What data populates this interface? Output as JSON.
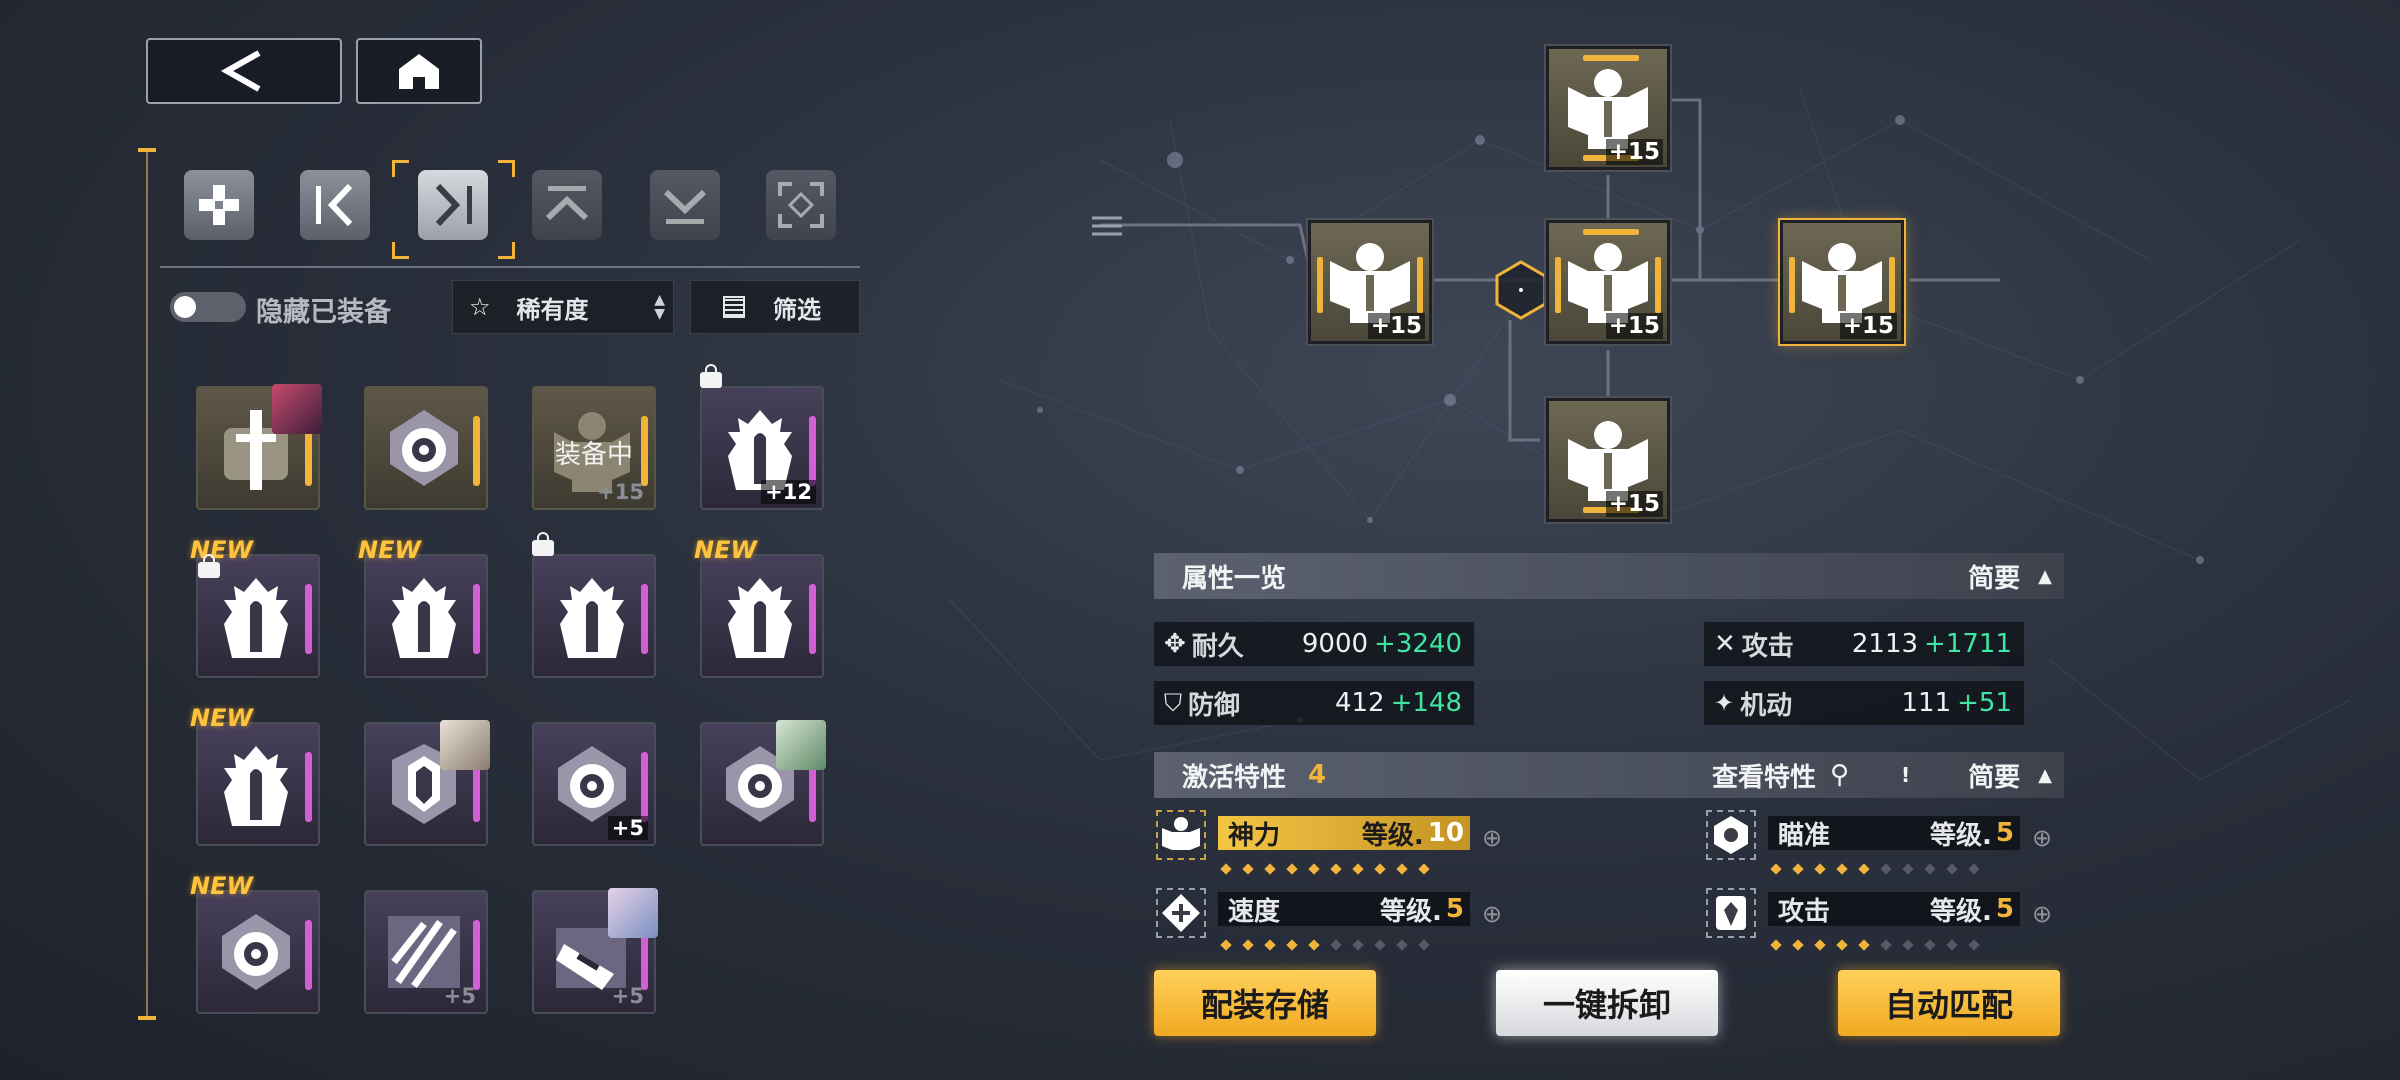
{
  "nav": {
    "back_icon": "chevron-left-icon",
    "home_icon": "home-icon"
  },
  "category_tabs": [
    {
      "icon": "cross-icon",
      "state": "normal"
    },
    {
      "icon": "chevron-left-bracket-icon",
      "state": "normal"
    },
    {
      "icon": "chevron-right-bracket-icon",
      "state": "selected"
    },
    {
      "icon": "chevron-up-icon",
      "state": "dim"
    },
    {
      "icon": "chevron-down-icon",
      "state": "dim"
    },
    {
      "icon": "frame-icon",
      "state": "dim"
    }
  ],
  "filters": {
    "hide_equipped_label": "隐藏已装备",
    "sort_label": "稀有度",
    "filter_label": "筛选"
  },
  "items": [
    {
      "type": "gold",
      "icon": "blade-icon",
      "avatar": true
    },
    {
      "type": "gold",
      "icon": "target-icon"
    },
    {
      "type": "gold",
      "icon": "armor-icon",
      "equipped_label": "装备中",
      "level": "+15",
      "level_faint": true
    },
    {
      "type": "purple",
      "icon": "spike-icon",
      "lock": true,
      "level": "+12"
    },
    {
      "type": "purple",
      "icon": "spike-icon",
      "new": "NEW",
      "lock": true
    },
    {
      "type": "purple",
      "icon": "spike-icon",
      "new": "NEW"
    },
    {
      "type": "purple",
      "icon": "spike-icon",
      "lock": true
    },
    {
      "type": "purple",
      "icon": "spike-icon",
      "new": "NEW"
    },
    {
      "type": "purple",
      "icon": "spike-icon",
      "new": "NEW"
    },
    {
      "type": "purple",
      "icon": "shield-icon",
      "avatar": true
    },
    {
      "type": "purple",
      "icon": "target-icon",
      "level": "+5"
    },
    {
      "type": "purple",
      "icon": "target-icon",
      "avatar": true
    },
    {
      "type": "purple",
      "icon": "target-icon",
      "new": "NEW"
    },
    {
      "type": "purple",
      "icon": "claw-icon",
      "level": "+5",
      "level_faint": true
    },
    {
      "type": "purple",
      "icon": "weapon-icon",
      "avatar": true,
      "level": "+5",
      "level_faint": true
    }
  ],
  "nodes": [
    {
      "name": "top",
      "level": "+15"
    },
    {
      "name": "left",
      "level": "+15"
    },
    {
      "name": "center",
      "level": "+15"
    },
    {
      "name": "right",
      "level": "+15"
    },
    {
      "name": "bottom",
      "level": "+15"
    }
  ],
  "attributes": {
    "title": "属性一览",
    "toggle": "简要",
    "stats": [
      {
        "label": "耐久",
        "value": "9000",
        "bonus": "+3240",
        "icon": "durability-icon"
      },
      {
        "label": "攻击",
        "value": "2113",
        "bonus": "+1711",
        "icon": "attack-icon"
      },
      {
        "label": "防御",
        "value": "412",
        "bonus": "+148",
        "icon": "defense-icon"
      },
      {
        "label": "机动",
        "value": "111",
        "bonus": "+51",
        "icon": "mobility-icon"
      }
    ]
  },
  "traits": {
    "title": "激活特性",
    "count": "4",
    "view_label": "查看特性",
    "toggle": "简要",
    "list": [
      {
        "name": "神力",
        "level_label": "等级.",
        "level": "10",
        "highlight": true,
        "dots_filled": 10,
        "dots_total": 10
      },
      {
        "name": "瞄准",
        "level_label": "等级.",
        "level": "5",
        "dots_filled": 5,
        "dots_total": 10
      },
      {
        "name": "速度",
        "level_label": "等级.",
        "level": "5",
        "dots_filled": 5,
        "dots_total": 10
      },
      {
        "name": "攻击",
        "level_label": "等级.",
        "level": "5",
        "dots_filled": 5,
        "dots_total": 10
      }
    ]
  },
  "actions": {
    "save": "配装存储",
    "unequip": "一键拆卸",
    "auto": "自动匹配"
  },
  "colors": {
    "accent_gold": "#f0b43a",
    "bonus_green": "#3ee6a1",
    "rarity_purple": "#d15fd6"
  }
}
